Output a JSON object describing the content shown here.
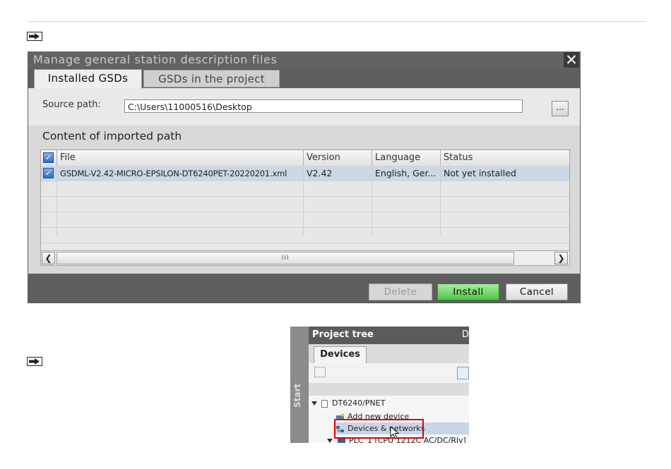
{
  "dialog": {
    "title": "Manage general station description files",
    "close_symbol": "✕",
    "tabs": [
      {
        "label": "Installed GSDs",
        "active": true
      },
      {
        "label": "GSDs in the project",
        "active": false
      }
    ],
    "source_path": {
      "label": "Source path:",
      "value": "C:\\Users\\11000516\\Desktop",
      "browse_label": "..."
    },
    "content_heading": "Content of imported path",
    "table": {
      "columns": [
        "File",
        "Version",
        "Language",
        "Status"
      ],
      "rows": [
        {
          "checked": true,
          "file": "GSDML-V2.42-MICRO-EPSILON-DT6240PET-20220201.xml",
          "version": "V2.42",
          "language": "English, Ger...",
          "status": "Not yet installed"
        }
      ],
      "scroll_thumb_grip": "III"
    },
    "buttons": {
      "delete": "Delete",
      "install": "Install",
      "cancel": "Cancel"
    }
  },
  "project_tree": {
    "title": "Project tree",
    "title_right": "D",
    "side_label": "Start",
    "tab": "Devices",
    "nodes": {
      "root": "DT6240/PNET",
      "add_device": "Add new device",
      "devices_networks": "Devices & networks",
      "plc": "PLC_1 [CPU 1212C AC/DC/Rly]"
    }
  },
  "colors": {
    "install_green": "#4ec548",
    "highlight_red": "#e00000",
    "selection_blue": "#cdd7e6",
    "checkbox_blue": "#2f6cc4"
  },
  "icons": [
    "arrow-right-icon",
    "close-icon",
    "checkbox-checked-icon",
    "scroll-left-icon",
    "scroll-right-icon",
    "expand-triangle-icon",
    "document-icon",
    "device-icon",
    "mouse-cursor-icon"
  ]
}
